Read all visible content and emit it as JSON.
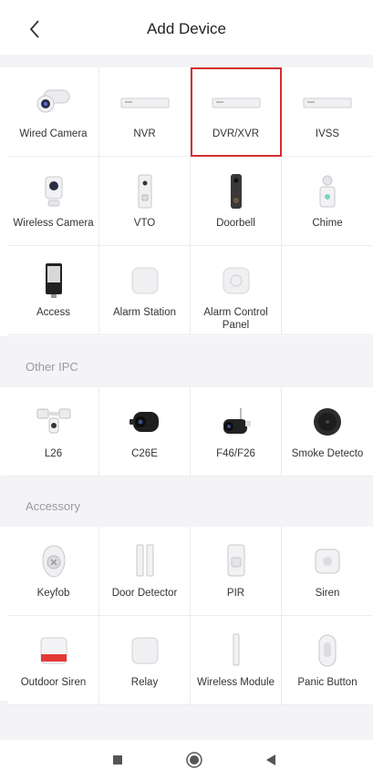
{
  "header": {
    "title": "Add Device"
  },
  "devices": [
    {
      "label": "Wired Camera",
      "icon": "bullet-camera-icon"
    },
    {
      "label": "NVR",
      "icon": "nvr-recorder-icon"
    },
    {
      "label": "DVR/XVR",
      "icon": "dvr-recorder-icon",
      "selected": true
    },
    {
      "label": "IVSS",
      "icon": "ivss-recorder-icon"
    },
    {
      "label": "Wireless Camera",
      "icon": "wireless-camera-icon"
    },
    {
      "label": "VTO",
      "icon": "vto-panel-icon"
    },
    {
      "label": "Doorbell",
      "icon": "doorbell-icon"
    },
    {
      "label": "Chime",
      "icon": "chime-icon"
    },
    {
      "label": "Access",
      "icon": "access-terminal-icon"
    },
    {
      "label": "Alarm Station",
      "icon": "alarm-station-icon"
    },
    {
      "label": "Alarm Control Panel",
      "icon": "alarm-control-panel-icon"
    }
  ],
  "sections": {
    "other_ipc": "Other IPC",
    "accessory": "Accessory"
  },
  "other_ipc": [
    {
      "label": "L26",
      "icon": "floodlight-camera-icon"
    },
    {
      "label": "C26E",
      "icon": "cube-camera-icon"
    },
    {
      "label": "F46/F26",
      "icon": "bullet-wifi-camera-icon"
    },
    {
      "label": "Smoke Detecto",
      "icon": "smoke-detector-icon"
    }
  ],
  "accessory": [
    {
      "label": "Keyfob",
      "icon": "keyfob-icon"
    },
    {
      "label": "Door Detector",
      "icon": "door-detector-icon"
    },
    {
      "label": "PIR",
      "icon": "pir-sensor-icon"
    },
    {
      "label": "Siren",
      "icon": "siren-icon"
    },
    {
      "label": "Outdoor Siren",
      "icon": "outdoor-siren-icon"
    },
    {
      "label": "Relay",
      "icon": "relay-icon"
    },
    {
      "label": "Wireless Module",
      "icon": "wireless-module-icon"
    },
    {
      "label": "Panic Button",
      "icon": "panic-button-icon"
    }
  ],
  "colors": {
    "selected_border": "#d32f2f",
    "background": "#f4f4f6",
    "section_text": "#9a9a9e"
  }
}
